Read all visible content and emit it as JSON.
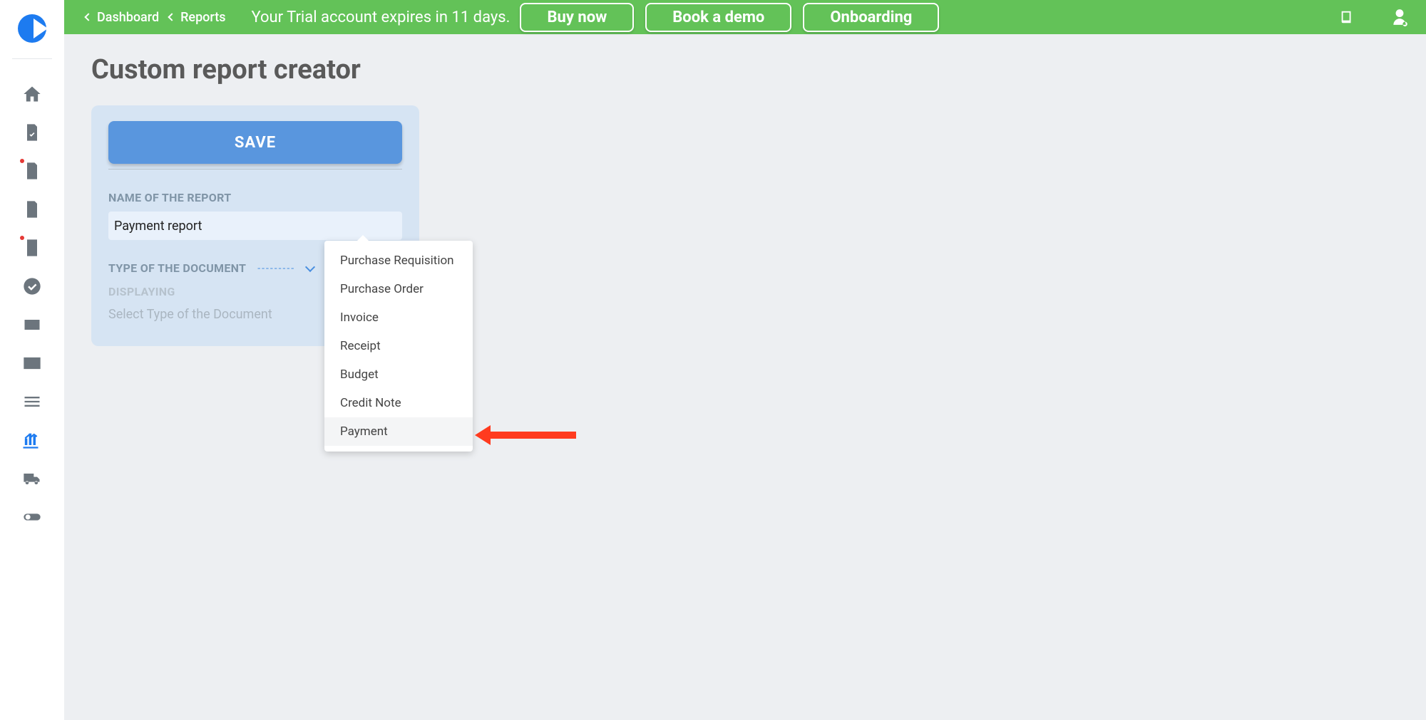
{
  "banner": {
    "breadcrumbs": [
      "Dashboard",
      "Reports"
    ],
    "trial_message": "Your Trial account expires in 11 days.",
    "buttons": {
      "buy": "Buy now",
      "demo": "Book a demo",
      "onboarding": "Onboarding"
    }
  },
  "page": {
    "title": "Custom report creator"
  },
  "form": {
    "save_label": "SAVE",
    "name_label": "NAME OF THE REPORT",
    "name_value": "Payment report",
    "type_label": "TYPE OF THE DOCUMENT",
    "type_placeholder": "---------",
    "displaying_label": "DISPLAYING",
    "displaying_text": "Select Type of the Document"
  },
  "dropdown": {
    "options": [
      "Purchase Requisition",
      "Purchase Order",
      "Invoice",
      "Receipt",
      "Budget",
      "Credit Note",
      "Payment"
    ],
    "highlighted_index": 6
  }
}
